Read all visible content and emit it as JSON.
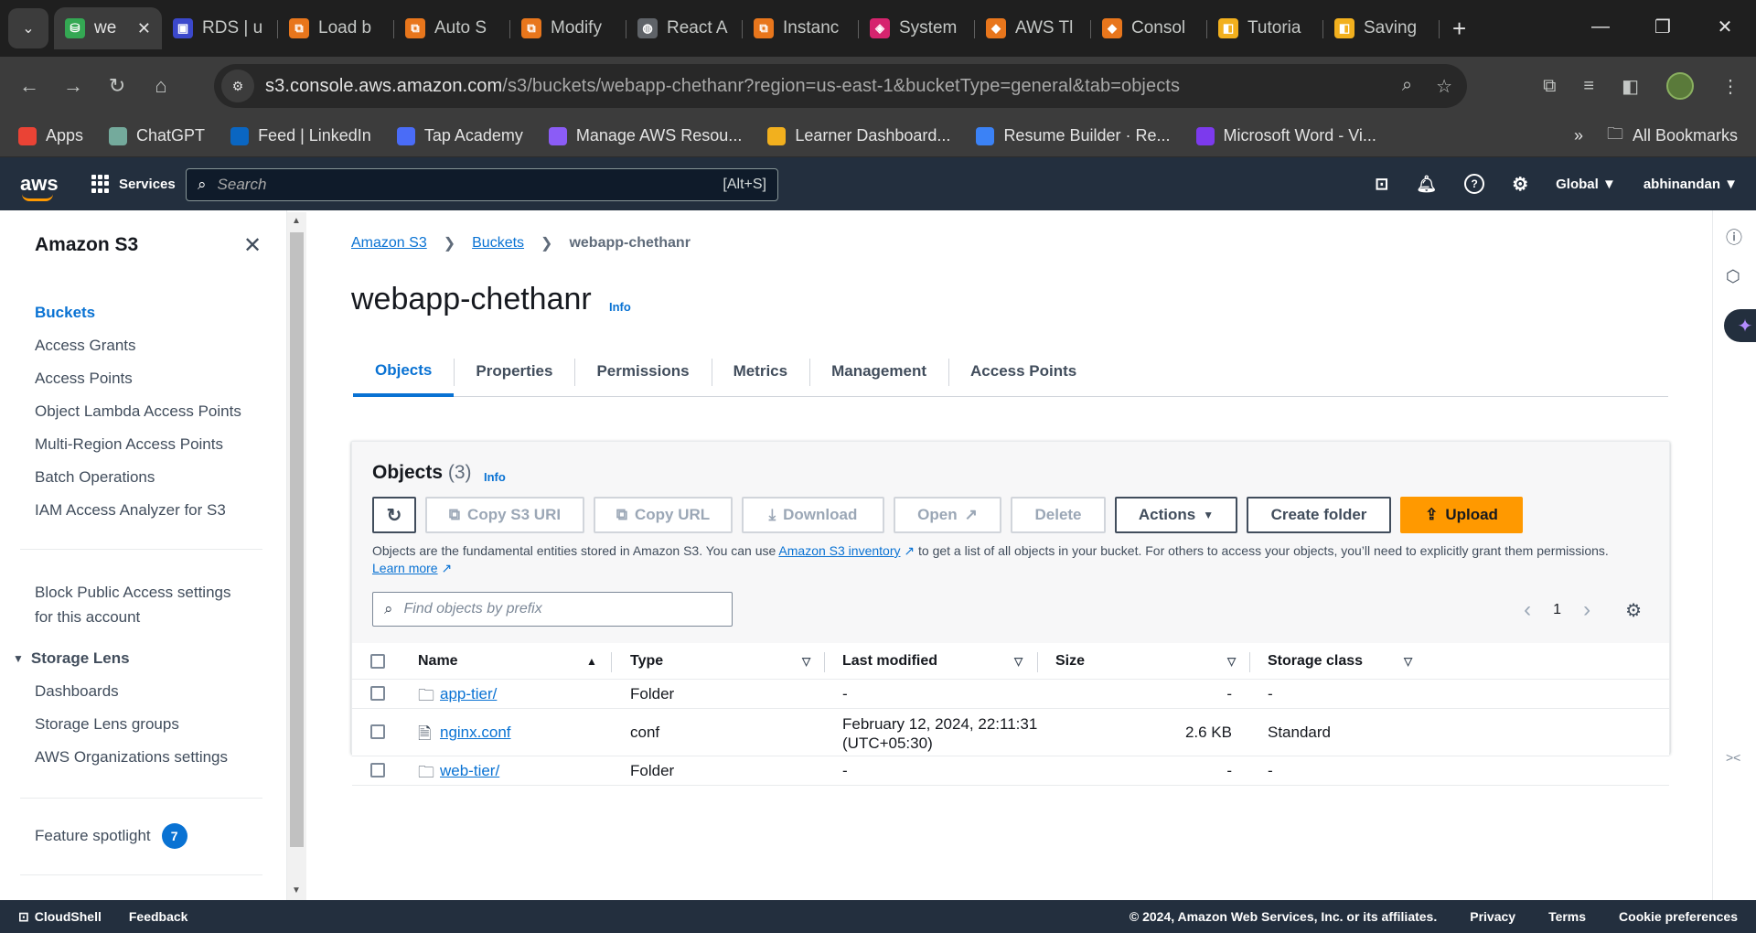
{
  "browser": {
    "tabs": [
      {
        "label": "we",
        "color": "#34a853",
        "glyph": "⛁",
        "active": true
      },
      {
        "label": "RDS | u",
        "color": "#3b48cc",
        "glyph": "▣"
      },
      {
        "label": "Load b",
        "color": "#e8761c",
        "glyph": "⧉"
      },
      {
        "label": "Auto S",
        "color": "#e8761c",
        "glyph": "⧉"
      },
      {
        "label": "Modify",
        "color": "#e8761c",
        "glyph": "⧉"
      },
      {
        "label": "React A",
        "color": "#5f6368",
        "glyph": "◍"
      },
      {
        "label": "Instanc",
        "color": "#e8761c",
        "glyph": "⧉"
      },
      {
        "label": "System",
        "color": "#d6246e",
        "glyph": "◈"
      },
      {
        "label": "AWS Tl",
        "color": "#e8761c",
        "glyph": "◆"
      },
      {
        "label": "Consol",
        "color": "#e8761c",
        "glyph": "◆"
      },
      {
        "label": "Tutoria",
        "color": "#f2b01e",
        "glyph": "◧"
      },
      {
        "label": "Saving",
        "color": "#f2b01e",
        "glyph": "◧"
      }
    ],
    "url_host": "s3.console.aws.amazon.com",
    "url_path": "/s3/buckets/webapp-chethanr?region=us-east-1&bucketType=general&tab=objects",
    "bookmarks": [
      {
        "label": "Apps",
        "color": "#ea4335"
      },
      {
        "label": "ChatGPT",
        "color": "#74aa9c"
      },
      {
        "label": "Feed | LinkedIn",
        "color": "#0a66c2"
      },
      {
        "label": "Tap Academy",
        "color": "#4a6cf7"
      },
      {
        "label": "Manage AWS Resou...",
        "color": "#8b5cf6"
      },
      {
        "label": "Learner Dashboard...",
        "color": "#f2b01e"
      },
      {
        "label": "Resume Builder · Re...",
        "color": "#3b82f6"
      },
      {
        "label": "Microsoft Word - Vi...",
        "color": "#7c3aed"
      }
    ],
    "bookmarks_overflow": "»",
    "all_bookmarks": "All Bookmarks"
  },
  "aws": {
    "logo": "aws",
    "services": "Services",
    "search_placeholder": "Search",
    "search_shortcut": "[Alt+S]",
    "region": "Global ▼",
    "user": "abhinandan ▼"
  },
  "sidebar": {
    "title": "Amazon S3",
    "items": [
      "Buckets",
      "Access Grants",
      "Access Points",
      "Object Lambda Access Points",
      "Multi-Region Access Points",
      "Batch Operations",
      "IAM Access Analyzer for S3"
    ],
    "block_public_line1": "Block Public Access settings",
    "block_public_line2": "for this account",
    "storage_lens": "Storage Lens",
    "storage_lens_items": [
      "Dashboards",
      "Storage Lens groups",
      "AWS Organizations settings"
    ],
    "feature_spotlight": "Feature spotlight",
    "feature_count": "7"
  },
  "breadcrumb": {
    "root": "Amazon S3",
    "buckets": "Buckets",
    "current": "webapp-chethanr"
  },
  "page": {
    "title": "webapp-chethanr",
    "info": "Info",
    "tabs": [
      "Objects",
      "Properties",
      "Permissions",
      "Metrics",
      "Management",
      "Access Points"
    ]
  },
  "objects": {
    "title": "Objects",
    "count": "(3)",
    "info": "Info",
    "buttons": {
      "copy_s3_uri": "Copy S3 URI",
      "copy_url": "Copy URL",
      "download": "Download",
      "open": "Open",
      "delete": "Delete",
      "actions": "Actions",
      "create_folder": "Create folder",
      "upload": "Upload"
    },
    "desc_1": "Objects are the fundamental entities stored in Amazon S3. You can use",
    "desc_link": "Amazon S3 inventory",
    "desc_2": "to get a list of all objects in your bucket. For others to access your objects, you’ll need to explicitly grant them permissions.",
    "learn_more": "Learn more",
    "filter_placeholder": "Find objects by prefix",
    "page_number": "1",
    "columns": [
      "Name",
      "Type",
      "Last modified",
      "Size",
      "Storage class"
    ],
    "rows": [
      {
        "name": "app-tier/",
        "type": "Folder",
        "modified": "-",
        "modified2": "",
        "size": "-",
        "class": "-",
        "kind": "folder"
      },
      {
        "name": "nginx.conf",
        "type": "conf",
        "modified": "February 12, 2024, 22:11:31",
        "modified2": "(UTC+05:30)",
        "size": "2.6 KB",
        "class": "Standard",
        "kind": "file"
      },
      {
        "name": "web-tier/",
        "type": "Folder",
        "modified": "-",
        "modified2": "",
        "size": "-",
        "class": "-",
        "kind": "folder"
      }
    ]
  },
  "footer": {
    "cloudshell": "CloudShell",
    "feedback": "Feedback",
    "copyright": "© 2024, Amazon Web Services, Inc. or its affiliates.",
    "privacy": "Privacy",
    "terms": "Terms",
    "cookies": "Cookie preferences"
  }
}
